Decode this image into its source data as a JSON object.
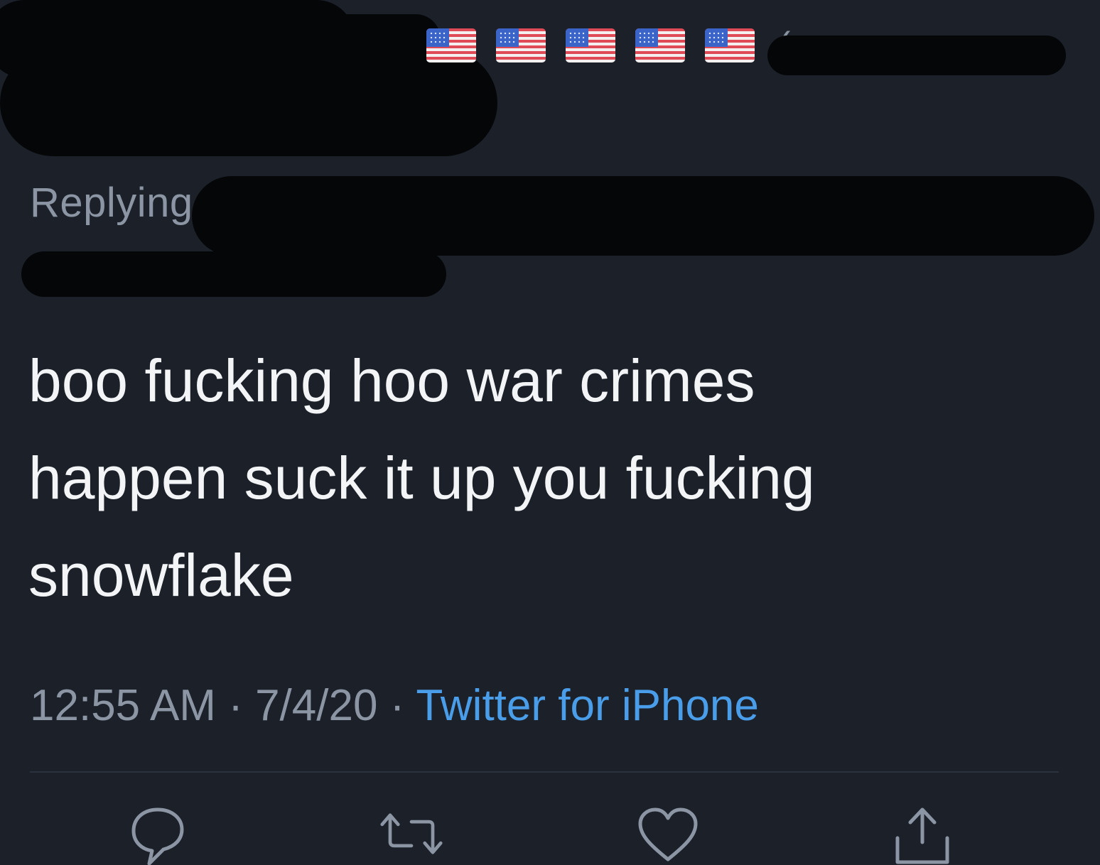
{
  "header": {
    "redacted": true,
    "flag_icon": "us-flag-icon",
    "flag_count": 5,
    "paren_fragment": "("
  },
  "reply": {
    "prefix": "Replying"
  },
  "tweet": {
    "text": "boo fucking hoo war crimes\nhappen suck it up you fucking\nsnowflake"
  },
  "meta": {
    "time": "12:55 AM",
    "sep1": " · ",
    "date": "7/4/20",
    "sep2": " · ",
    "source": "Twitter for iPhone"
  },
  "actions": [
    {
      "name": "reply",
      "icon": "reply-icon"
    },
    {
      "name": "retweet",
      "icon": "retweet-icon"
    },
    {
      "name": "like",
      "icon": "heart-icon"
    },
    {
      "name": "share",
      "icon": "share-icon"
    }
  ],
  "colors": {
    "background": "#1b2029",
    "text": "#f3f4f6",
    "muted": "#8b95a3",
    "link": "#4a9de8"
  }
}
